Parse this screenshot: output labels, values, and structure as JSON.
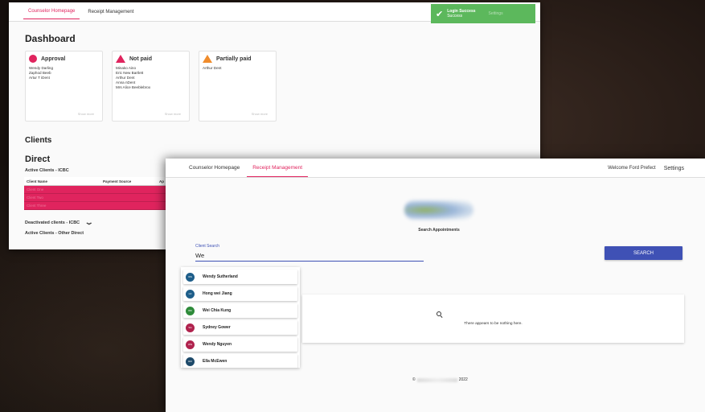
{
  "back_window": {
    "tabs": [
      "Counselor Homepage",
      "Receipt Management"
    ],
    "toast": {
      "title": "Login Success",
      "message": "Success",
      "ghost_settings": "Settings"
    },
    "dashboard_title": "Dashboard",
    "cards": [
      {
        "title": "Approval",
        "icon": "circle-icon",
        "names": [
          "Wendy Darling",
          "Zaphod Beeb",
          "Artur T iDent"
        ],
        "footer": "Show more"
      },
      {
        "title": "Not paid",
        "icon": "warning-triangle-icon",
        "names": [
          "Minako Aino",
          "Eric New Bartlett",
          "Arthur Dent",
          "Anna nDent",
          "Mrs Alice Beeblebrox"
        ],
        "footer": "Show more"
      },
      {
        "title": "Partially paid",
        "icon": "warning-triangle-icon",
        "names": [
          "Arthur Dent"
        ],
        "footer": "Show more"
      }
    ],
    "clients_title": "Clients",
    "direct_title": "Direct",
    "active_icbc": "Active Clients - ICBC",
    "table_headers": [
      "Client Name",
      "Payment Source",
      "Ap"
    ],
    "table_rows": [
      [
        "Client One",
        "",
        ""
      ],
      [
        "Client Two",
        "",
        ""
      ],
      [
        "Client Three",
        "",
        ""
      ]
    ],
    "deactivated": "Deactivated clients - ICBC",
    "active_other": "Active Clients - Other Direct"
  },
  "front_window": {
    "tabs": [
      "Counselor Homepage",
      "Receipt Management"
    ],
    "welcome": "Welcome Ford Prefect",
    "settings": "Settings",
    "search_heading": "Search Appointments",
    "field_label": "Client Search",
    "field_value": "We",
    "search_button": "SEARCH",
    "empty_message": "There appears to be nothing here.",
    "dropdown": [
      {
        "name": "Wendy Sutherland",
        "color": "#1e5e8a"
      },
      {
        "name": "Hong wei Jiang",
        "color": "#1e5e8a"
      },
      {
        "name": "Wei Chia Kung",
        "color": "#2e8b3a"
      },
      {
        "name": "Sydney Gower",
        "color": "#b0234e"
      },
      {
        "name": "Wendy Nguyen",
        "color": "#b0234e"
      },
      {
        "name": "Ella McEwen",
        "color": "#1e4a6a"
      }
    ],
    "footer_prefix": "©",
    "footer_year": "2022"
  },
  "colors": {
    "accent": "#e0245e",
    "primary": "#3f51b5",
    "success": "#5cb85c",
    "warning": "#f08c2c"
  }
}
